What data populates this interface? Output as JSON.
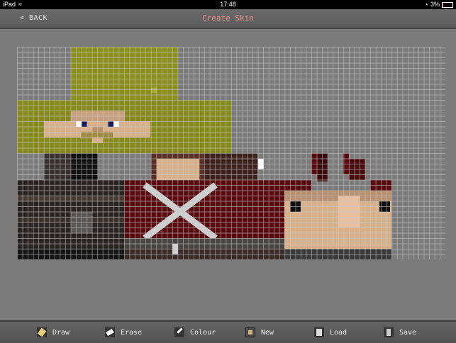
{
  "status_bar": {
    "device": "iPad",
    "time": "17:48",
    "battery": "3%"
  },
  "header": {
    "back_label": "< BACK",
    "title": "Create Skin"
  },
  "toolbar": {
    "items": [
      {
        "label": "Draw",
        "icon": "pencil-icon"
      },
      {
        "label": "Erase",
        "icon": "eraser-icon"
      },
      {
        "label": "Colour",
        "icon": "brush-icon"
      },
      {
        "label": "New",
        "icon": "new-skin-icon"
      },
      {
        "label": "Load",
        "icon": "load-icon"
      },
      {
        "label": "Save",
        "icon": "save-icon"
      }
    ]
  },
  "colors": {
    "accent_title": "#ff8f8f",
    "hat": "#8a8f1e",
    "dark_red": "#5a0b10",
    "skin": "#d8b08a",
    "dark_brown": "#3a2a25",
    "grey_dark": "#2a2a2a"
  }
}
